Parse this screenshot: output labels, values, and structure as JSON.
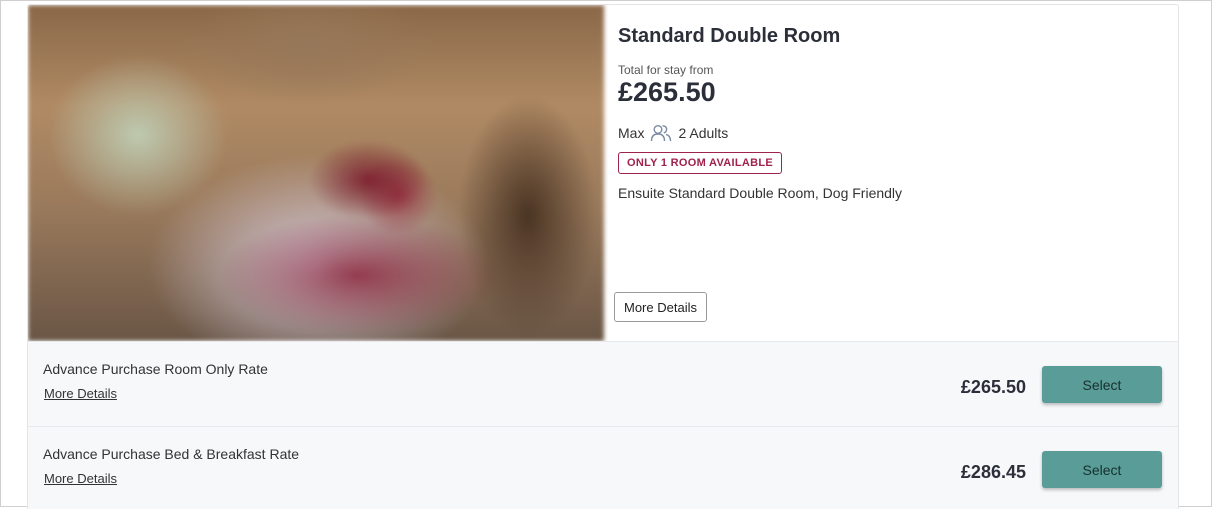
{
  "room": {
    "title": "Standard Double Room",
    "price_label": "Total for stay from",
    "price": "£265.50",
    "max_label": "Max",
    "occupancy": "2 Adults",
    "availability_badge": "ONLY 1 ROOM AVAILABLE",
    "description": "Ensuite Standard Double Room, Dog Friendly",
    "more_details_label": "More Details",
    "people_icon": "people-icon"
  },
  "rates": [
    {
      "name": "Advance Purchase Room Only Rate",
      "link_label": "More Details",
      "price": "£265.50",
      "select_label": "Select"
    },
    {
      "name": "Advance Purchase Bed & Breakfast Rate",
      "link_label": "More Details",
      "price": "£286.45",
      "select_label": "Select"
    }
  ],
  "colors": {
    "accent_button": "#5a9c98",
    "badge": "#a0224e"
  }
}
